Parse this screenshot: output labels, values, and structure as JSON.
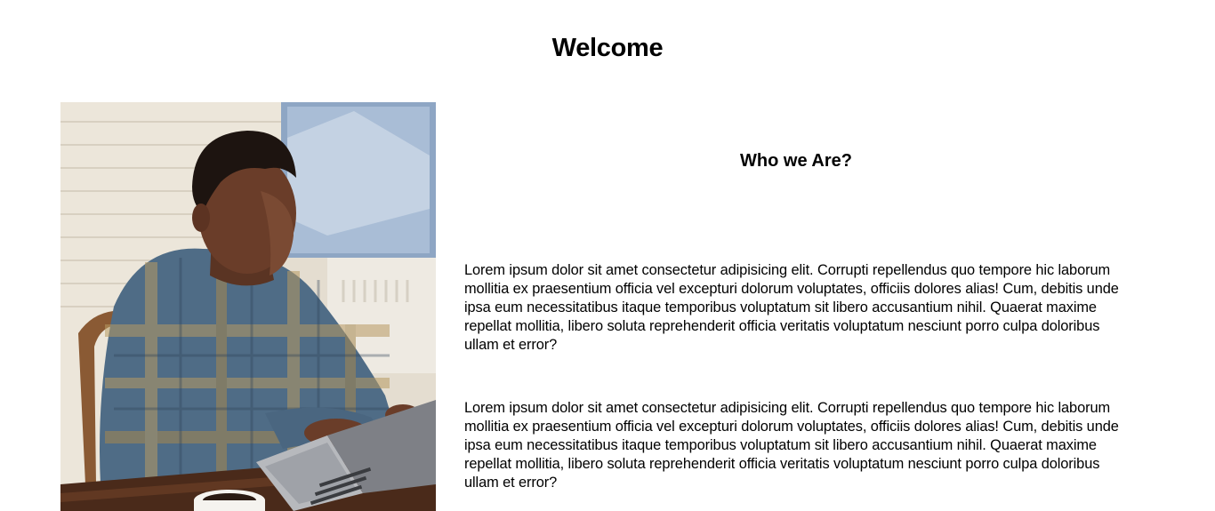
{
  "page": {
    "title": "Welcome"
  },
  "about": {
    "heading": "Who we Are?",
    "paragraphs": [
      "Lorem ipsum dolor sit amet consectetur adipisicing elit. Corrupti repellendus quo tempore hic laborum mollitia ex praesentium officia vel excepturi dolorum voluptates, officiis dolores alias! Cum, debitis unde ipsa eum necessitatibus itaque temporibus voluptatum sit libero accusantium nihil. Quaerat maxime repellat mollitia, libero soluta reprehenderit officia veritatis voluptatum nesciunt porro culpa doloribus ullam et error?",
      "Lorem ipsum dolor sit amet consectetur adipisicing elit. Corrupti repellendus quo tempore hic laborum mollitia ex praesentium officia vel excepturi dolorum voluptates, officiis dolores alias! Cum, debitis unde ipsa eum necessitatibus itaque temporibus voluptatum sit libero accusantium nihil. Quaerat maxime repellat mollitia, libero soluta reprehenderit officia veritatis voluptatum nesciunt porro culpa doloribus ullam et error?"
    ]
  },
  "colors": {
    "background": "#ffffff",
    "text": "#000000"
  }
}
